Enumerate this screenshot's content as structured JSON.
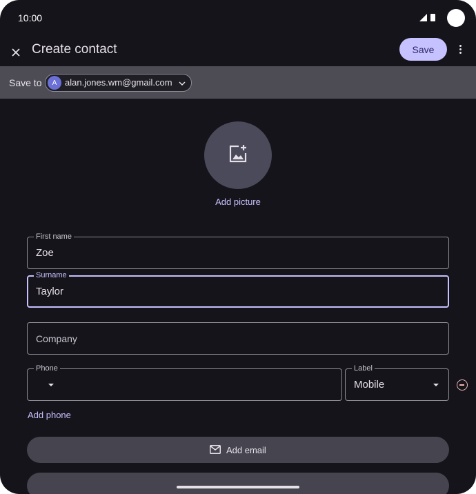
{
  "status_bar": {
    "time": "10:00"
  },
  "app_bar": {
    "title": "Create contact",
    "save_label": "Save"
  },
  "account": {
    "label": "Save to",
    "avatar_letter": "A",
    "email": "alan.jones.wm@gmail.com"
  },
  "picture": {
    "add_label": "Add picture"
  },
  "fields": {
    "first_name": {
      "label": "First name",
      "value": "Zoe"
    },
    "surname": {
      "label": "Surname",
      "value": "Taylor"
    },
    "company": {
      "placeholder": "Company"
    },
    "phone": {
      "label": "Phone",
      "value": ""
    },
    "phone_label": {
      "label": "Label",
      "value": "Mobile"
    }
  },
  "actions": {
    "add_phone": "Add phone",
    "add_email": "Add email"
  },
  "icons": {
    "close": "close-icon",
    "more": "more-vert-icon",
    "chevron": "chevron-down-icon",
    "add_photo": "add-photo-icon",
    "mail": "mail-icon",
    "remove": "remove-circle-icon"
  },
  "colors": {
    "accent": "#c6c1ff",
    "background": "#15141a",
    "remove": "#f2b8b5"
  }
}
